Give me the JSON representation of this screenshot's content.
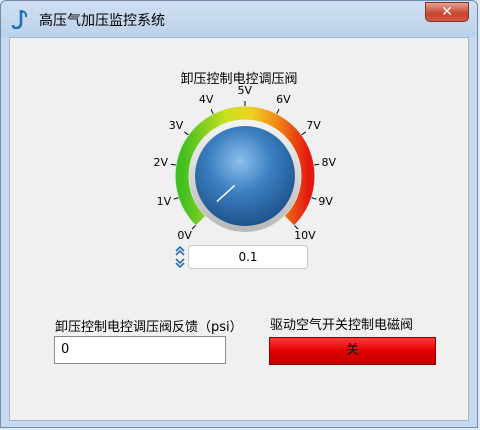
{
  "window": {
    "title": "高压气加压监控系统",
    "close_label": "✕"
  },
  "gauge": {
    "title": "卸压控制电控调压阀",
    "min": 0,
    "max": 10,
    "unit": "V",
    "tick_labels": [
      "0V",
      "1V",
      "2V",
      "3V",
      "4V",
      "5V",
      "6V",
      "7V",
      "8V",
      "9V",
      "10V"
    ],
    "value": 0.1,
    "value_display": "0.1",
    "colors": {
      "low": "#3fbf22",
      "mid": "#e8e020",
      "high": "#e41a10",
      "knob": "#2f6fb0"
    }
  },
  "feedback": {
    "label": "卸压控制电控调压阀反馈（psi）",
    "value": "0"
  },
  "valve": {
    "label": "驱动空气开关控制电磁阀",
    "button_label": "关",
    "color": "#e00000"
  }
}
